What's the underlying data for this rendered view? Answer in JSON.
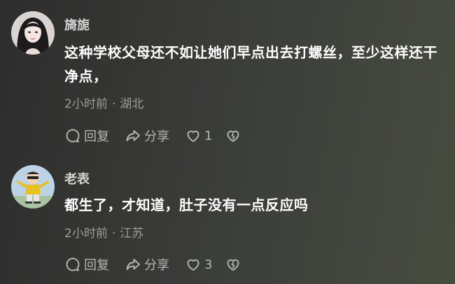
{
  "comments": [
    {
      "username": "旖旎",
      "text": "这种学校父母还不如让她们早点出去打螺丝，至少这样还干净点，",
      "time": "2小时前",
      "location": "湖北",
      "actions": {
        "reply": "回复",
        "share": "分享",
        "likes": "1"
      },
      "icons": [
        "reply-icon",
        "share-icon",
        "heart-icon",
        "broken-heart-icon"
      ]
    },
    {
      "username": "老表",
      "text": "都生了，才知道，肚子没有一点反应吗",
      "time": "2小时前",
      "location": "江苏",
      "actions": {
        "reply": "回复",
        "share": "分享",
        "likes": "3"
      },
      "icons": [
        "reply-icon",
        "share-icon",
        "heart-icon",
        "broken-heart-icon"
      ]
    }
  ],
  "separator": "·"
}
